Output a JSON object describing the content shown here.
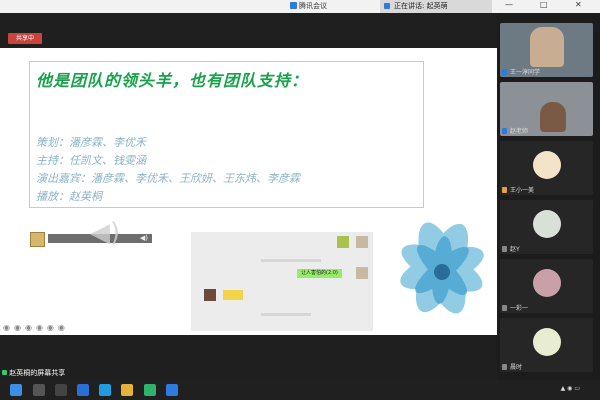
{
  "window": {
    "title": "腾讯会议",
    "tab_label": "正在讲话: 起英萌",
    "min": "—",
    "max": "□",
    "close": "✕"
  },
  "share_label": "共享中",
  "slide": {
    "headline": "他是团队的领头羊，也有团队支持：",
    "credits": [
      "策划：潘彦霖、李优禾",
      "主持：任凯文、钱雯涵",
      "演出嘉宾：潘彦霖、李优禾、王欣妍、王东炜、李彦霖",
      "播放：赵英桐"
    ]
  },
  "chat": {
    "bubble_text": "让人害怕的(2.0)"
  },
  "participants": [
    {
      "name": "王一淳同学"
    },
    {
      "name": "赵老师"
    },
    {
      "name": "王小一美"
    },
    {
      "name": "赵Y"
    },
    {
      "name": "一彩一"
    },
    {
      "name": "晨时"
    }
  ],
  "status_text": "赵英桐的屏幕共享",
  "colors": {
    "headline_green": "#16a34a",
    "credits_blue": "#8ab3c9",
    "share_red": "#c9453b",
    "accent_blue": "#2e7be0"
  }
}
